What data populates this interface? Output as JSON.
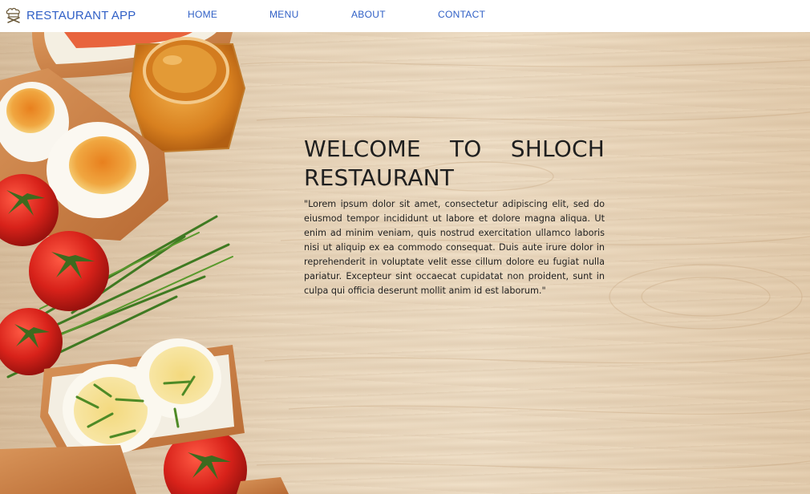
{
  "nav": {
    "brand": "RESTAURANT APP",
    "brand_icon": "chef-hat-icon",
    "links": [
      "HOME",
      "MENU",
      "ABOUT",
      "CONTACT"
    ],
    "link_color": "#2f5fc6"
  },
  "hero": {
    "title": "WELCOME TO SHLOCH RESTAURANT",
    "body": "\"Lorem ipsum dolor sit amet, consectetur adipiscing elit, sed do eiusmod tempor incididunt ut labore et dolore magna aliqua. Ut enim ad minim veniam, quis nostrud exercitation ullamco laboris nisi ut aliquip ex ea commodo consequat. Duis aute irure dolor in reprehenderit in voluptate velit esse cillum dolore eu fugiat nulla pariatur. Excepteur sint occaecat cupidatat non proident, sunt in culpa qui officia deserunt mollit anim id est laborum.\"",
    "background": "wood-table-with-toasts-eggs-tomatoes-honey-jar"
  }
}
